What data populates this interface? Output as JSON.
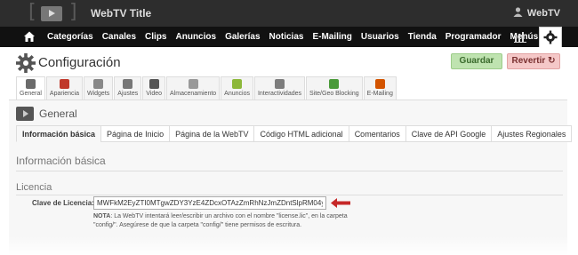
{
  "header": {
    "site_title": "WebTV Title",
    "user_label": "WebTV"
  },
  "nav": {
    "items": [
      "Categorías",
      "Canales",
      "Clips",
      "Anuncios",
      "Galerías",
      "Noticias",
      "E-Mailing",
      "Usuarios",
      "Tienda",
      "Programador",
      "Menús",
      "API"
    ]
  },
  "page": {
    "title": "Configuración",
    "save_label": "Guardar",
    "revert_label": "Revertir"
  },
  "icon_tabs": [
    {
      "label": "General",
      "color": "#6b6b6b"
    },
    {
      "label": "Apariencia",
      "color": "#c0392b"
    },
    {
      "label": "Widgets",
      "color": "#888"
    },
    {
      "label": "Ajustes",
      "color": "#777"
    },
    {
      "label": "Video",
      "color": "#555"
    },
    {
      "label": "Almacenamiento",
      "color": "#999"
    },
    {
      "label": "Anuncios",
      "color": "#8db83a"
    },
    {
      "label": "Interactividades",
      "color": "#7d7d7d"
    },
    {
      "label": "Site/Geo Blocking",
      "color": "#4a9a3a"
    },
    {
      "label": "E-Mailing",
      "color": "#d35400"
    }
  ],
  "section": {
    "title": "General",
    "sub_tabs": [
      "Información básica",
      "Página de Inicio",
      "Página de la WebTV",
      "Código HTML adicional",
      "Comentarios",
      "Clave de API Google",
      "Ajustes Regionales"
    ],
    "heading": "Información básica",
    "license_heading": "Licencia",
    "license_label": "Clave de Licencia:",
    "license_value": "MWFkM2EyZTI0MTgwZDY3YzE4ZDcxOTAzZmRhNzJmZDntSlpRM04yRU",
    "note_bold": "NOTA",
    "note_text": ": La WebTV intentará leer/escribir un archivo con el nombre \"license.lic\", en la carpeta \"config/\". Asegúrese de que la carpeta \"config/\" tiene permisos de escritura."
  }
}
